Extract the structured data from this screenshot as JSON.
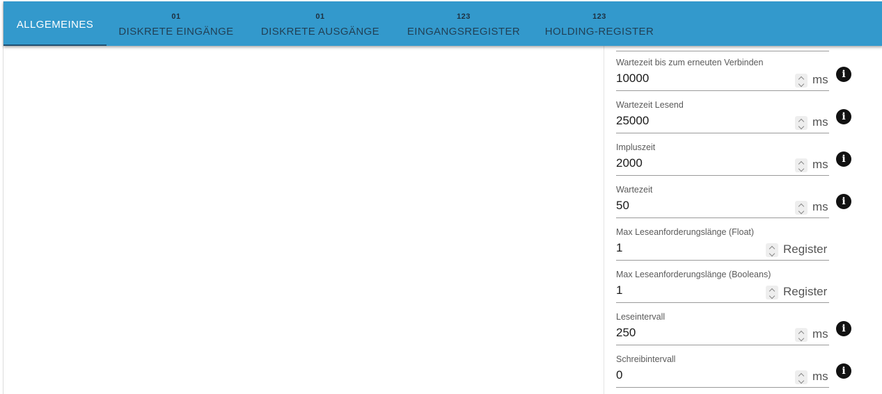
{
  "tabs": [
    {
      "label": "ALLGEMEINES",
      "icon": "",
      "active": true
    },
    {
      "label": "DISKRETE EINGÄNGE",
      "icon": "01",
      "active": false
    },
    {
      "label": "DISKRETE AUSGÄNGE",
      "icon": "01",
      "active": false
    },
    {
      "label": "EINGANGSREGISTER",
      "icon": "123",
      "active": false
    },
    {
      "label": "HOLDING-REGISTER",
      "icon": "123",
      "active": false
    }
  ],
  "colors": {
    "tabbar": "#3399cc",
    "indicator": "#1f4e70"
  },
  "fields": [
    {
      "label": "Wartezeit bis zum erneuten Verbinden",
      "value": "10000",
      "unit": "ms",
      "info": true
    },
    {
      "label": "Wartezeit Lesend",
      "value": "25000",
      "unit": "ms",
      "info": true
    },
    {
      "label": "Impluszeit",
      "value": "2000",
      "unit": "ms",
      "info": true
    },
    {
      "label": "Wartezeit",
      "value": "50",
      "unit": "ms",
      "info": true
    },
    {
      "label": "Max Leseanforderungslänge (Float)",
      "value": "1",
      "unit": "Register",
      "info": false
    },
    {
      "label": "Max Leseanforderungslänge (Booleans)",
      "value": "1",
      "unit": "Register",
      "info": false
    },
    {
      "label": "Leseintervall",
      "value": "250",
      "unit": "ms",
      "info": true
    },
    {
      "label": "Schreibintervall",
      "value": "0",
      "unit": "ms",
      "info": true
    }
  ],
  "info_icon_glyph": "i"
}
